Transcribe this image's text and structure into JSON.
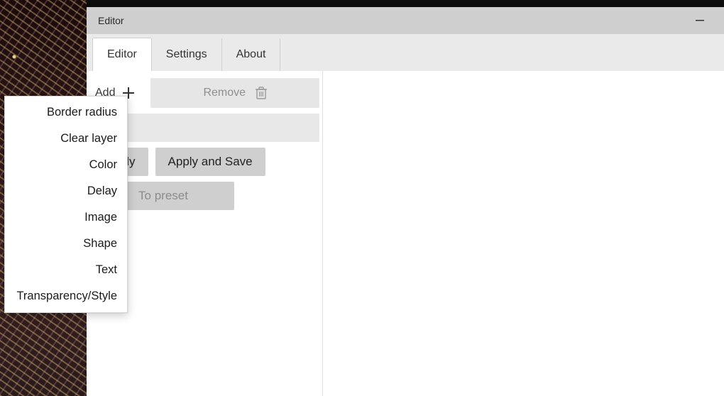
{
  "window": {
    "title": "Editor"
  },
  "tabs": {
    "editor": "Editor",
    "settings": "Settings",
    "about": "About"
  },
  "toolbar": {
    "add_label": "Add",
    "remove_label": "Remove"
  },
  "buttons": {
    "apply": "Apply",
    "apply_and_save": "Apply and Save",
    "to_preset": "To preset"
  },
  "add_menu": {
    "items": [
      "Border radius",
      "Clear layer",
      "Color",
      "Delay",
      "Image",
      "Shape",
      "Text",
      "Transparency/Style"
    ]
  }
}
